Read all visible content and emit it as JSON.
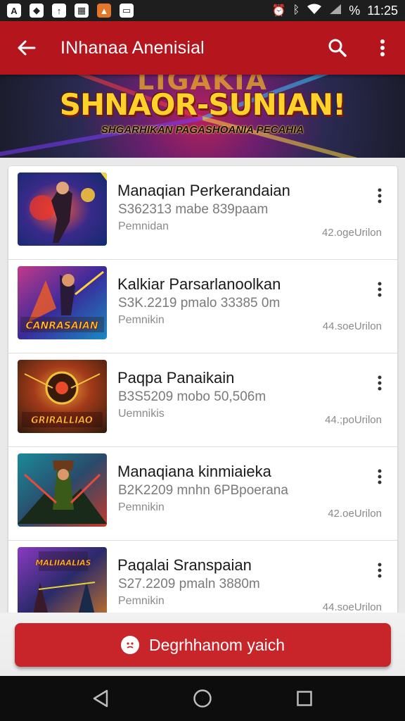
{
  "status_bar": {
    "left_icons": [
      "app-a-icon",
      "app-shield-icon",
      "app-upload-icon",
      "app-grid-icon",
      "app-photo-icon",
      "app-mail-icon"
    ],
    "right_icons": [
      "alarm-icon",
      "bluetooth-icon",
      "wifi-icon",
      "signal-icon"
    ],
    "battery_text": "%",
    "time": "11:25"
  },
  "app_bar": {
    "title": "INhanaa Anenisial",
    "back_icon": "arrow-left-icon",
    "search_icon": "search-icon",
    "more_icon": "more-vertical-icon"
  },
  "banner": {
    "top_text": "LIGAKIA",
    "title": "SHNAOR-SUNIAN!",
    "subtitle": "SHGARHIKAN   PAGASHOANIA PECAHIA"
  },
  "items": [
    {
      "title": "Manaqian Perkerandaian",
      "subtitle": "S362313 mabe 839paam",
      "author": "Pemnidan",
      "meta": "42.ogeUrilon",
      "thumb_text": ""
    },
    {
      "title": "Kalkiar Parsarlanoolkan",
      "subtitle": "S3K.2219 pmalo 33385 0m",
      "author": "Pemnikin",
      "meta": "44.soeUrilon",
      "thumb_text": "CANRASAIAN"
    },
    {
      "title": "Paqpa Panaikain",
      "subtitle": "B3S5209 mobo 50,506m",
      "author": "Uemnikis",
      "meta": "44.;poUrilon",
      "thumb_text": "GRIRALLIAO"
    },
    {
      "title": "Manaqiana kinmiaieka",
      "subtitle": "B2K2209 mnhn 6PBpoerana",
      "author": "Pemnikin",
      "meta": "42.oeUrilon",
      "thumb_text": ""
    },
    {
      "title": "Paqalai Sranspaian",
      "subtitle": "S27.2209 pmaln 3880m",
      "author": "Pemnikin",
      "meta": "44.soeUrilon",
      "thumb_text": "MALIIAALIAS"
    }
  ],
  "cta": {
    "label": "Degrhhanom yaich",
    "icon": "sad-face-icon"
  },
  "nav_bar": {
    "icons": [
      "back-triangle-icon",
      "home-circle-icon",
      "recents-square-icon"
    ]
  },
  "colors": {
    "primary": "#b5161e",
    "cta": "#c8252a",
    "status_bar": "#1e1e1e",
    "nav_bar": "#0d0d0d"
  }
}
